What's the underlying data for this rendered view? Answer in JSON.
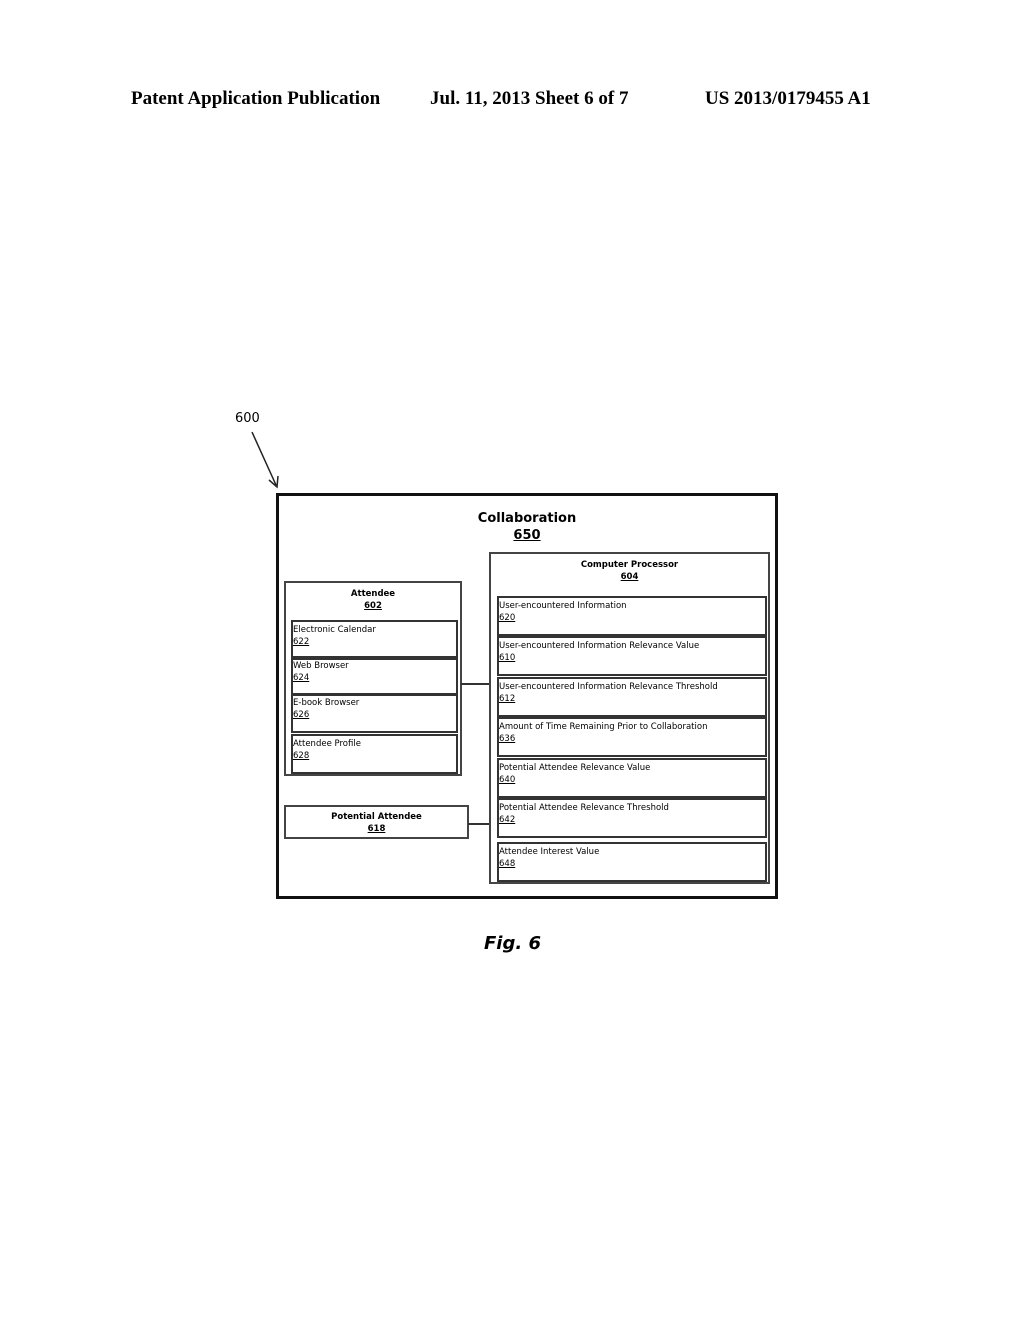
{
  "header": {
    "left": "Patent Application Publication",
    "middle": "Jul. 11, 2013   Sheet 6 of 7",
    "right": "US 2013/0179455 A1"
  },
  "figure_ref": "600",
  "collaboration": {
    "title": "Collaboration",
    "number": "650"
  },
  "attendee": {
    "title": "Attendee",
    "number": "602",
    "items": [
      {
        "label": "Electronic Calendar",
        "number": "622"
      },
      {
        "label": "Web Browser",
        "number": "624"
      },
      {
        "label": "E-book Browser",
        "number": "626"
      },
      {
        "label": "Attendee Profile",
        "number": "628"
      }
    ]
  },
  "potential_attendee": {
    "title": "Potential Attendee",
    "number": "618"
  },
  "processor": {
    "title": "Computer Processor",
    "number": "604",
    "items": [
      {
        "label": "User-encountered Information",
        "number": "620"
      },
      {
        "label": "User-encountered Information Relevance Value",
        "number": "610"
      },
      {
        "label": "User-encountered Information Relevance Threshold",
        "number": "612"
      },
      {
        "label": "Amount of Time Remaining Prior to Collaboration",
        "number": "636"
      },
      {
        "label": "Potential Attendee Relevance Value",
        "number": "640"
      },
      {
        "label": "Potential Attendee Relevance Threshold",
        "number": "642"
      },
      {
        "label": "Attendee Interest Value",
        "number": "648"
      }
    ]
  },
  "caption": "Fig. 6"
}
